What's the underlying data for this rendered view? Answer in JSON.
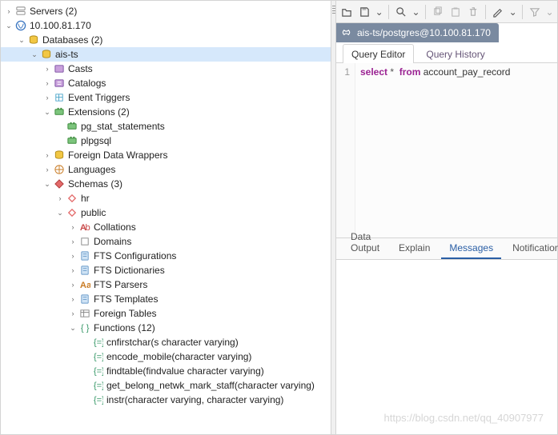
{
  "tree": [
    {
      "depth": 0,
      "chev": "closed",
      "icon": "servers",
      "label": "Servers (2)",
      "interactable": true
    },
    {
      "depth": 0,
      "chev": "open",
      "icon": "pgserver",
      "label": "10.100.81.170",
      "interactable": true
    },
    {
      "depth": 1,
      "chev": "open",
      "icon": "db-group",
      "label": "Databases (2)",
      "interactable": true
    },
    {
      "depth": 2,
      "chev": "open",
      "icon": "db",
      "label": "ais-ts",
      "sel": true,
      "interactable": true
    },
    {
      "depth": 3,
      "chev": "closed",
      "icon": "casts",
      "label": "Casts",
      "interactable": true
    },
    {
      "depth": 3,
      "chev": "closed",
      "icon": "catalogs",
      "label": "Catalogs",
      "interactable": true
    },
    {
      "depth": 3,
      "chev": "closed",
      "icon": "event",
      "label": "Event Triggers",
      "interactable": true
    },
    {
      "depth": 3,
      "chev": "open",
      "icon": "ext",
      "label": "Extensions (2)",
      "interactable": true
    },
    {
      "depth": 4,
      "chev": "none",
      "icon": "ext-item",
      "label": "pg_stat_statements",
      "interactable": true
    },
    {
      "depth": 4,
      "chev": "none",
      "icon": "ext-item",
      "label": "plpgsql",
      "interactable": true
    },
    {
      "depth": 3,
      "chev": "closed",
      "icon": "fdw",
      "label": "Foreign Data Wrappers",
      "interactable": true
    },
    {
      "depth": 3,
      "chev": "closed",
      "icon": "lang",
      "label": "Languages",
      "interactable": true
    },
    {
      "depth": 3,
      "chev": "open",
      "icon": "schemas",
      "label": "Schemas (3)",
      "interactable": true
    },
    {
      "depth": 4,
      "chev": "closed",
      "icon": "schema",
      "label": "hr",
      "interactable": true
    },
    {
      "depth": 4,
      "chev": "open",
      "icon": "schema",
      "label": "public",
      "interactable": true
    },
    {
      "depth": 5,
      "chev": "closed",
      "icon": "collation",
      "label": "Collations",
      "interactable": true
    },
    {
      "depth": 5,
      "chev": "closed",
      "icon": "domain",
      "label": "Domains",
      "interactable": true
    },
    {
      "depth": 5,
      "chev": "closed",
      "icon": "fts",
      "label": "FTS Configurations",
      "interactable": true
    },
    {
      "depth": 5,
      "chev": "closed",
      "icon": "fts",
      "label": "FTS Dictionaries",
      "interactable": true
    },
    {
      "depth": 5,
      "chev": "closed",
      "icon": "fts-aa",
      "label": "FTS Parsers",
      "interactable": true
    },
    {
      "depth": 5,
      "chev": "closed",
      "icon": "fts",
      "label": "FTS Templates",
      "interactable": true
    },
    {
      "depth": 5,
      "chev": "closed",
      "icon": "ftable",
      "label": "Foreign Tables",
      "interactable": true
    },
    {
      "depth": 5,
      "chev": "open",
      "icon": "func",
      "label": "Functions (12)",
      "interactable": true
    },
    {
      "depth": 6,
      "chev": "none",
      "icon": "func-fn",
      "label": "cnfirstchar(s character varying)",
      "interactable": true
    },
    {
      "depth": 6,
      "chev": "none",
      "icon": "func-fn",
      "label": "encode_mobile(character varying)",
      "interactable": true
    },
    {
      "depth": 6,
      "chev": "none",
      "icon": "func-fn",
      "label": "findtable(findvalue character varying)",
      "interactable": true
    },
    {
      "depth": 6,
      "chev": "none",
      "icon": "func-fn",
      "label": "get_belong_netwk_mark_staff(character varying)",
      "interactable": true
    },
    {
      "depth": 6,
      "chev": "none",
      "icon": "func-fn",
      "label": "instr(character varying, character varying)",
      "interactable": true
    }
  ],
  "toolbar": [
    {
      "name": "open-icon",
      "glyph": "open",
      "drop": false,
      "dis": false
    },
    {
      "name": "save-icon",
      "glyph": "save",
      "drop": true,
      "dis": false
    },
    {
      "type": "sep"
    },
    {
      "name": "find-icon",
      "glyph": "search",
      "drop": true,
      "dis": false
    },
    {
      "type": "sep"
    },
    {
      "name": "copy-icon",
      "glyph": "copy",
      "drop": false,
      "dis": true
    },
    {
      "name": "paste-icon",
      "glyph": "paste",
      "drop": false,
      "dis": true
    },
    {
      "name": "delete-icon",
      "glyph": "trash",
      "drop": false,
      "dis": true
    },
    {
      "type": "sep"
    },
    {
      "name": "edit-icon",
      "glyph": "edit",
      "drop": true,
      "dis": false
    },
    {
      "type": "sep"
    },
    {
      "name": "filter-icon",
      "glyph": "filter",
      "drop": true,
      "dis": true
    }
  ],
  "connection_tab": "ais-ts/postgres@10.100.81.170",
  "editor_tabs": [
    {
      "label": "Query Editor",
      "active": true
    },
    {
      "label": "Query History",
      "active": false
    }
  ],
  "code": {
    "line_no": "1",
    "tokens": [
      {
        "t": "select",
        "cls": "kw"
      },
      {
        "t": " * ",
        "cls": "op"
      },
      {
        "t": " from ",
        "cls": "kw"
      },
      {
        "t": "account_pay_record",
        "cls": "ident"
      }
    ]
  },
  "results_tabs": [
    {
      "label": "Data Output",
      "active": false
    },
    {
      "label": "Explain",
      "active": false
    },
    {
      "label": "Messages",
      "active": true
    },
    {
      "label": "Notifications",
      "active": false
    }
  ],
  "watermark": "https://blog.csdn.net/qq_40907977"
}
